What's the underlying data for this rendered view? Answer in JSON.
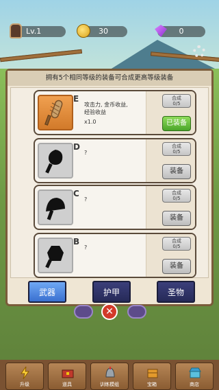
{
  "topbar": {
    "level": "Lv.1",
    "coins": "30",
    "gems": "0"
  },
  "dialog": {
    "header": "拥有5个相同等级的装备可合成更高等级装备",
    "cards": [
      {
        "grade": "E",
        "desc_line1": "攻击力, 金币收益,",
        "desc_line2": "经验收益",
        "multiplier": "x1.0",
        "merge_label": "合成",
        "merge_count": "0/5",
        "equip_label": "已装备",
        "equipped": true,
        "icon": "wooden-club-icon"
      },
      {
        "grade": "D",
        "desc_line1": "?",
        "merge_label": "合成",
        "merge_count": "0/5",
        "equip_label": "装备",
        "equipped": false,
        "icon": "locked-weapon-silhouette-icon"
      },
      {
        "grade": "C",
        "desc_line1": "?",
        "merge_label": "合成",
        "merge_count": "0/5",
        "equip_label": "装备",
        "equipped": false,
        "icon": "locked-weapon-silhouette-icon"
      },
      {
        "grade": "B",
        "desc_line1": "?",
        "merge_label": "合成",
        "merge_count": "0/5",
        "equip_label": "装备",
        "equipped": false,
        "icon": "locked-weapon-silhouette-icon"
      }
    ],
    "tabs": [
      "武器",
      "护甲",
      "圣物"
    ],
    "active_tab": "武器"
  },
  "bottom_nav": [
    "升级",
    "道具",
    "训练模组",
    "宝箱",
    "商店"
  ],
  "colors": {
    "active_tab": "#3a70d0",
    "inactive_tab": "#262a58",
    "equipped_button": "#4aa52a",
    "card_border": "#5a4a3a"
  }
}
